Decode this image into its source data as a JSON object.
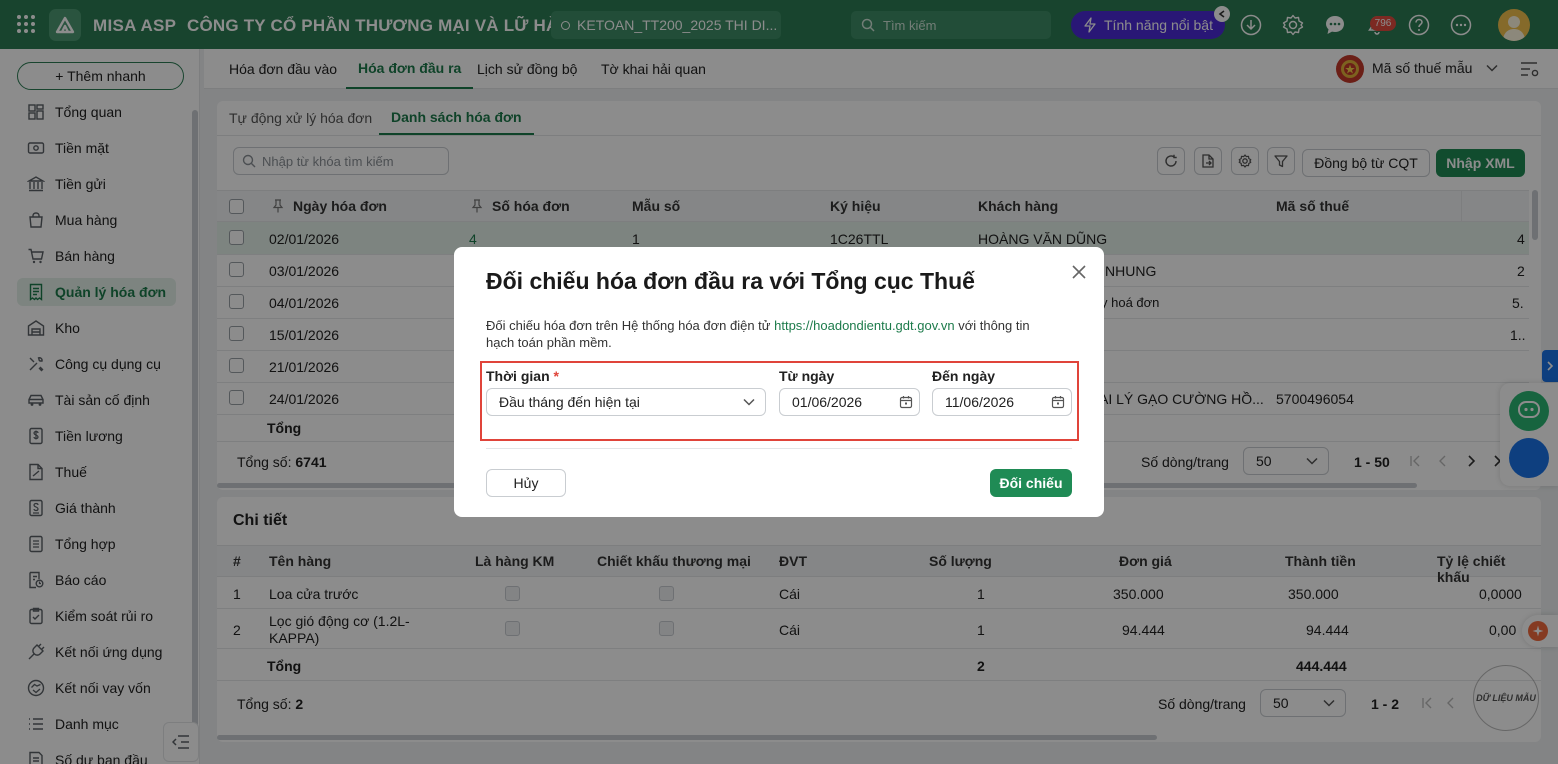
{
  "topbar": {
    "app_name": "MISA ASP",
    "company_name": "CÔNG TY CỔ PHẦN THƯƠNG MẠI VÀ LỮ HÀNH ...",
    "database_name": "KETOAN_TT200_2025 THI DI...",
    "search_placeholder": "Tìm kiếm",
    "feature_button": "Tính năng nổi bật",
    "notification_count": "796"
  },
  "sidebar": {
    "quick_add": "+ Thêm nhanh",
    "items": [
      {
        "label": "Tổng quan"
      },
      {
        "label": "Tiền mặt"
      },
      {
        "label": "Tiền gửi"
      },
      {
        "label": "Mua hàng"
      },
      {
        "label": "Bán hàng"
      },
      {
        "label": "Quản lý hóa đơn"
      },
      {
        "label": "Kho"
      },
      {
        "label": "Công cụ dụng cụ"
      },
      {
        "label": "Tài sản cố định"
      },
      {
        "label": "Tiền lương"
      },
      {
        "label": "Thuế"
      },
      {
        "label": "Giá thành"
      },
      {
        "label": "Tổng hợp"
      },
      {
        "label": "Báo cáo"
      },
      {
        "label": "Kiểm soát rủi ro"
      },
      {
        "label": "Kết nối ứng dụng"
      },
      {
        "label": "Kết nối vay vốn"
      },
      {
        "label": "Danh mục"
      },
      {
        "label": "Số dư ban đầu"
      }
    ]
  },
  "main_tabs": [
    "Hóa đơn đầu vào",
    "Hóa đơn đầu ra",
    "Lịch sử đồng bộ",
    "Tờ khai hải quan"
  ],
  "tax_code_selector": "Mã số thuế mẫu",
  "sub_tabs": [
    "Tự động xử lý hóa đơn",
    "Danh sách hóa đơn"
  ],
  "toolbar": {
    "search_placeholder": "Nhập từ khóa tìm kiếm",
    "sync_button": "Đồng bộ từ CQT",
    "import_button": "Nhập XML"
  },
  "invoice_table": {
    "headers": [
      "Ngày hóa đơn",
      "Số hóa đơn",
      "Mẫu số",
      "Ký hiệu",
      "Khách hàng",
      "Mã số thuế"
    ],
    "rows": [
      {
        "date": "02/01/2026",
        "number": "4",
        "form": "1",
        "symbol": "1C26TTL",
        "customer": "HOÀNG VĂN DŨNG",
        "tax": "4"
      },
      {
        "date": "03/01/2026",
        "number": "",
        "form": "",
        "symbol": "",
        "customer": "NHUNG",
        "tax": "2"
      },
      {
        "date": "04/01/2026",
        "number": "",
        "form": "",
        "symbol": "",
        "customer": "y hoá đơn",
        "tax": "5."
      },
      {
        "date": "15/01/2026",
        "number": "",
        "form": "",
        "symbol": "",
        "customer": "",
        "tax": "1.."
      },
      {
        "date": "21/01/2026",
        "number": "",
        "form": "",
        "symbol": "",
        "customer": "",
        "tax": ""
      },
      {
        "date": "24/01/2026",
        "number": "",
        "form": "",
        "symbol": "",
        "customer": "AI LÝ GẠO CƯỜNG HỒ...",
        "tax": "5700496054"
      }
    ],
    "total_label": "Tổng",
    "count_label": "Tổng số:",
    "count_value": "6741",
    "page_size_label": "Số dòng/trang",
    "page_size": "50",
    "range": "1 - 50"
  },
  "detail": {
    "title": "Chi tiết",
    "headers": [
      "#",
      "Tên hàng",
      "Là hàng KM",
      "Chiết khấu thương mại",
      "ĐVT",
      "Số lượng",
      "Đơn giá",
      "Thành tiền",
      "Tỷ lệ chiết khấu"
    ],
    "rows": [
      {
        "no": "1",
        "name": "Loa cửa trước",
        "unit": "Cái",
        "qty": "1",
        "price": "350.000",
        "amount": "350.000",
        "rate": "0,0000"
      },
      {
        "no": "2",
        "name": "Lọc gió động cơ (1.2L-KAPPA)",
        "unit": "Cái",
        "qty": "1",
        "price": "94.444",
        "amount": "94.444",
        "rate": "0,00"
      }
    ],
    "total_label": "Tổng",
    "total_qty": "2",
    "total_amount": "444.444",
    "count_label": "Tổng số:",
    "count_value": "2",
    "page_size_label": "Số dòng/trang",
    "page_size": "50",
    "range": "1 - 2"
  },
  "modal": {
    "title": "Đối chiếu hóa đơn đầu ra với Tổng cục Thuế",
    "desc_prefix": "Đối chiếu hóa đơn trên Hệ thống hóa đơn điện tử",
    "desc_link": "https://hoadondientu.gdt.gov.vn",
    "desc_suffix": "với thông tin",
    "desc_line2": "hạch toán phần mềm.",
    "period_label": "Thời gian",
    "required_mark": "*",
    "period_value": "Đầu tháng đến hiện tại",
    "from_label": "Từ ngày",
    "from_value": "01/06/2026",
    "to_label": "Đến ngày",
    "to_value": "11/06/2026",
    "cancel_button": "Hủy",
    "confirm_button": "Đối chiếu"
  },
  "watermark": "DỮ LIỆU MẪU",
  "colors": {
    "brand_green": "#2d7d55",
    "accent_green": "#1f8b55",
    "highlight_red": "#e0443a",
    "feature_purple": "#4b2bd8"
  }
}
